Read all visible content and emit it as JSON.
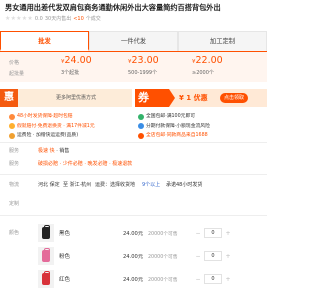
{
  "title": "男女通用出差代发双肩包商务通勤休闲外出大容量简约百搭背包外出",
  "rating": {
    "stars": "★★★★★",
    "score": "0.0",
    "sold_prefix": "30天内售出",
    "sold_count": "<10",
    "sold_unit": "个成交"
  },
  "tabs": [
    {
      "label": "批发"
    },
    {
      "label": "一件代发"
    },
    {
      "label": "加工定制"
    }
  ],
  "price": {
    "labels": [
      "价格",
      "起批量"
    ],
    "tiers": [
      {
        "currency": "¥",
        "amount": "24.00",
        "qty": "3个起批"
      },
      {
        "currency": "¥",
        "amount": "23.00",
        "qty": "500-1999个"
      },
      {
        "currency": "¥",
        "amount": "22.00",
        "qty": "≥2000个"
      }
    ]
  },
  "promo": {
    "hui_badge": "惠",
    "hui_text": "更多阿里优惠方式",
    "quan_badge": "券",
    "coupon_value": "¥ 1 优惠",
    "coupon_button": "点击领取"
  },
  "benefits_left": [
    "48小时发货保障·超时包赔",
    "假就赔付·免费退换货 · 满17件减1元",
    "运费险 · 加赠快运运费(品质)"
  ],
  "benefits_right": [
    "全国包邮·满100元即可",
    "分期付款保障·小额现金流风险",
    "全店包邮·同款商品来自1688"
  ],
  "rows": {
    "service_label": "服务",
    "service_items": [
      "极速",
      "快",
      "·",
      "销售"
    ],
    "guarantee_label": "服务",
    "guarantee_text": "破损必赔 · 少件必赔 · 晚发必赔 · 极速退款",
    "logistics_label": "物流",
    "logistics_from": "河北 保定",
    "logistics_to": "至 浙江·杭州",
    "logistics_fee": "运费：选择收货地",
    "logistics_stock": "9个以上",
    "logistics_ship": "承诺48小时发货",
    "custom_label": "定制"
  },
  "sku": {
    "label": "颜色",
    "items": [
      {
        "name": "黑色",
        "price": "24.00元",
        "stock": "20000个可售",
        "qty": "0",
        "color": "#222222"
      },
      {
        "name": "粉色",
        "price": "24.00元",
        "stock": "20000个可售",
        "qty": "0",
        "color": "#e46b9a"
      },
      {
        "name": "红色",
        "price": "24.00元",
        "stock": "20000个可售",
        "qty": "0",
        "color": "#d8323a"
      }
    ]
  },
  "colors": {
    "accent": "#ff5000",
    "price_bg": "#fff5ef"
  }
}
